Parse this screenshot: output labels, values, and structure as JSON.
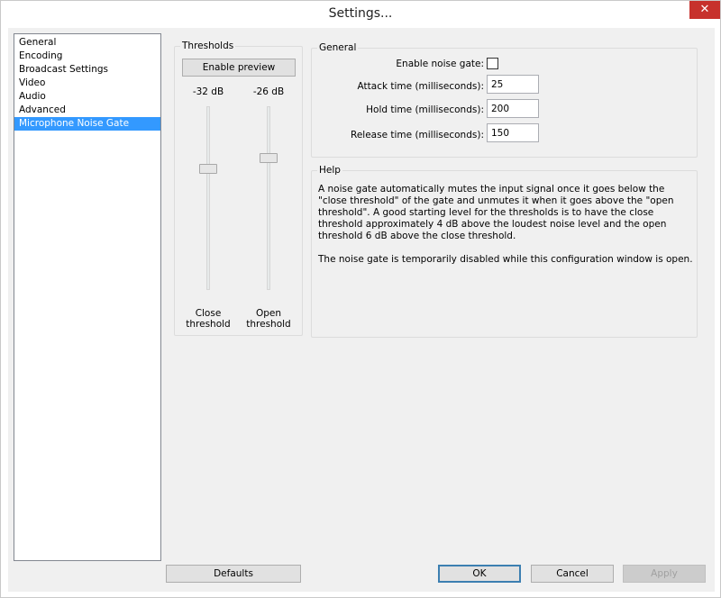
{
  "window": {
    "title": "Settings...",
    "close_glyph": "✕"
  },
  "sidebar": {
    "items": [
      {
        "label": "General"
      },
      {
        "label": "Encoding"
      },
      {
        "label": "Broadcast Settings"
      },
      {
        "label": "Video"
      },
      {
        "label": "Audio"
      },
      {
        "label": "Advanced"
      },
      {
        "label": "Microphone Noise Gate",
        "selected": true
      }
    ]
  },
  "thresholds": {
    "group_label": "Thresholds",
    "preview_button": "Enable preview",
    "close_value": "-32 dB",
    "open_value": "-26 dB",
    "close_label_line1": "Close",
    "close_label_line2": "threshold",
    "open_label_line1": "Open",
    "open_label_line2": "threshold",
    "close_level_db": -32,
    "open_level_db": -26
  },
  "general": {
    "group_label": "General",
    "enable_label": "Enable noise gate:",
    "enable_checked": false,
    "attack_label": "Attack time (milliseconds):",
    "attack_value": "25",
    "hold_label": "Hold time (milliseconds):",
    "hold_value": "200",
    "release_label": "Release time (milliseconds):",
    "release_value": "150"
  },
  "help": {
    "group_label": "Help",
    "paragraph1": "A noise gate automatically mutes the input signal once it goes below the \"close threshold\" of the gate and unmutes it when it goes above the \"open threshold\". A good starting level for the thresholds is to have the close threshold approximately 4 dB above the loudest noise level and the open threshold 6 dB above the close threshold.",
    "paragraph2": "The noise gate is temporarily disabled while this configuration window is open."
  },
  "buttons": {
    "defaults": "Defaults",
    "ok": "OK",
    "cancel": "Cancel",
    "apply": "Apply"
  },
  "colors": {
    "selection": "#3399ff",
    "close_button": "#c7312c",
    "window_bg": "#f0f0f0"
  }
}
